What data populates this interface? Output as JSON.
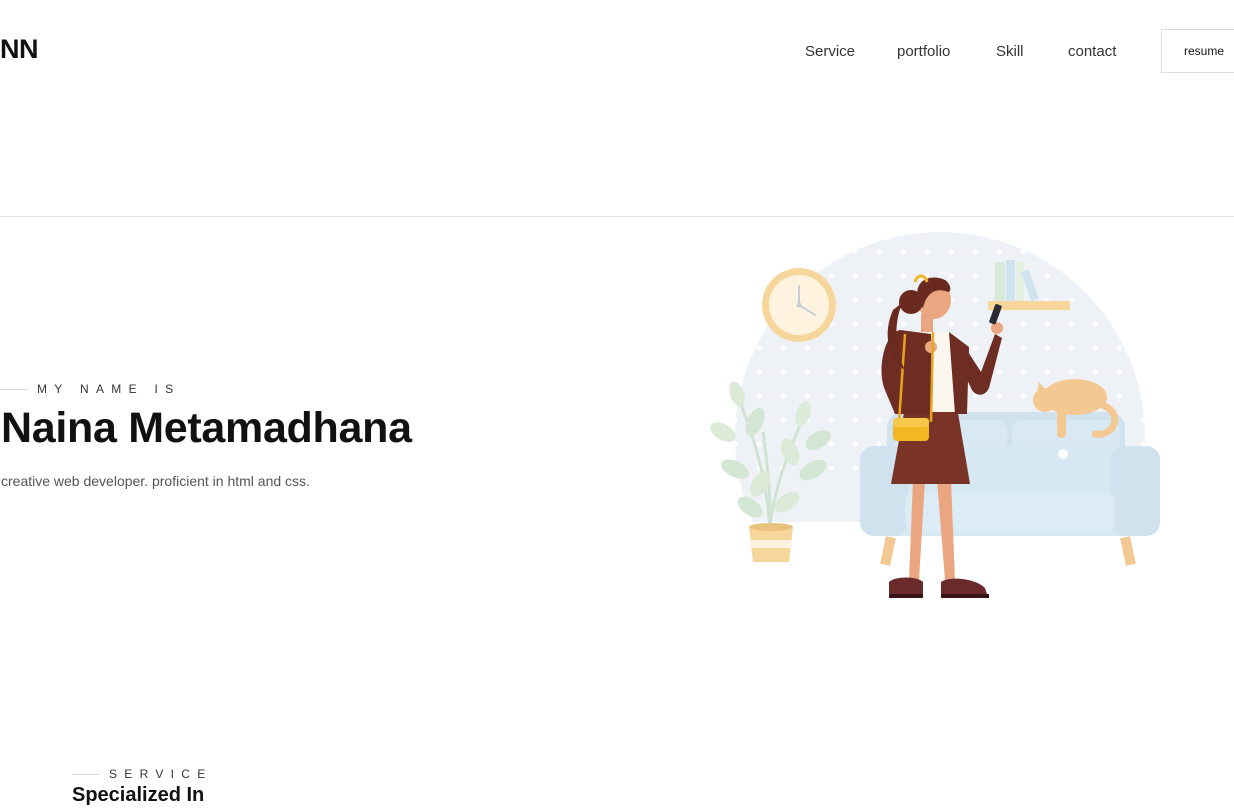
{
  "header": {
    "logo": "NN",
    "nav": [
      "Service",
      "portfolio",
      "Skill",
      "contact"
    ],
    "resume_label": "resume"
  },
  "hero": {
    "eyebrow": "MY NAME IS",
    "name": "Naina Metamadhana",
    "tagline": "creative web developer. proficient in html and css."
  },
  "services": {
    "eyebrow": "SERVICE",
    "title": "Specialized In"
  },
  "illustration": {
    "icons": [
      "wall-clock-icon",
      "person-icon",
      "phone-icon",
      "handbag-icon",
      "sofa-icon",
      "cat-icon",
      "potted-plant-icon",
      "shelf-icon"
    ]
  }
}
